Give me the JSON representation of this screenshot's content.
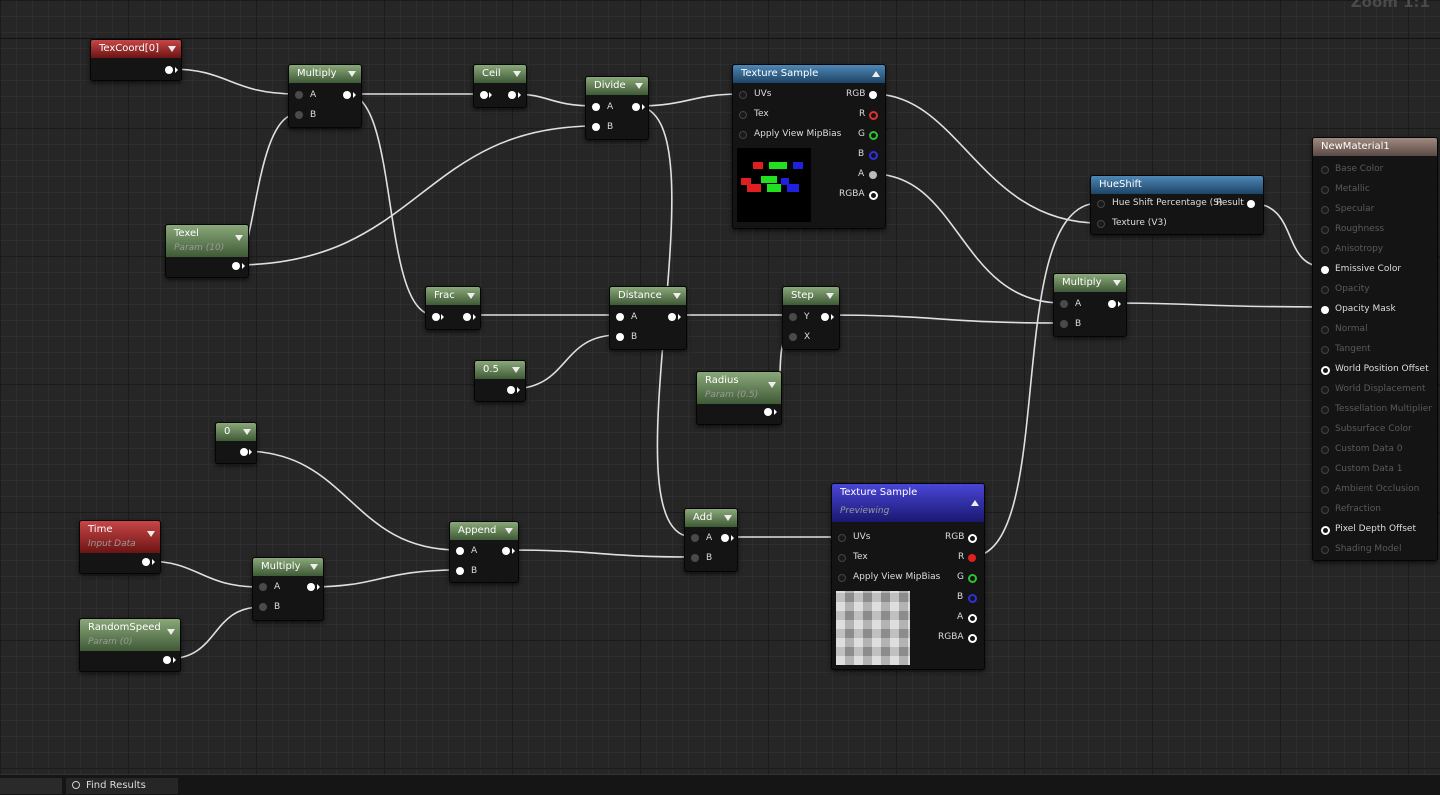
{
  "zoom_label": "Zoom 1:1",
  "status": {
    "find_results": "Find Results"
  },
  "nodes": {
    "texcoord": {
      "title": "TexCoord[0]"
    },
    "multiply1": {
      "title": "Multiply",
      "a": "A",
      "b": "B"
    },
    "ceil": {
      "title": "Ceil"
    },
    "divide": {
      "title": "Divide",
      "a": "A",
      "b": "B"
    },
    "texel": {
      "title": "Texel",
      "sub": "Param (10)"
    },
    "texsample1": {
      "title": "Texture Sample",
      "uvs": "UVs",
      "tex": "Tex",
      "mip": "Apply View MipBias",
      "rgb": "RGB",
      "r": "R",
      "g": "G",
      "b": "B",
      "a": "A",
      "rgba": "RGBA"
    },
    "hueshift": {
      "title": "HueShift",
      "in1": "Hue Shift Percentage (S)",
      "out": "Result",
      "in2": "Texture (V3)"
    },
    "multiply3": {
      "title": "Multiply",
      "a": "A",
      "b": "B"
    },
    "frac": {
      "title": "Frac"
    },
    "distance": {
      "title": "Distance",
      "a": "A",
      "b": "B"
    },
    "step": {
      "title": "Step",
      "y": "Y",
      "x": "X"
    },
    "half": {
      "title": "0.5"
    },
    "radius": {
      "title": "Radius",
      "sub": "Param (0.5)"
    },
    "zero": {
      "title": "0"
    },
    "time": {
      "title": "Time",
      "sub": "Input Data"
    },
    "append": {
      "title": "Append",
      "a": "A",
      "b": "B"
    },
    "add": {
      "title": "Add",
      "a": "A",
      "b": "B"
    },
    "multiply2": {
      "title": "Multiply",
      "a": "A",
      "b": "B"
    },
    "randomspeed": {
      "title": "RandomSpeed",
      "sub": "Param (0)"
    },
    "texsample2": {
      "title": "Texture Sample",
      "sub": "Previewing",
      "uvs": "UVs",
      "tex": "Tex",
      "mip": "Apply View MipBias",
      "rgb": "RGB",
      "r": "R",
      "g": "G",
      "b": "B",
      "a": "A",
      "rgba": "RGBA"
    }
  },
  "material": {
    "title": "NewMaterial1",
    "inputs": [
      {
        "label": "Base Color",
        "active": false
      },
      {
        "label": "Metallic",
        "active": false
      },
      {
        "label": "Specular",
        "active": false
      },
      {
        "label": "Roughness",
        "active": false
      },
      {
        "label": "Anisotropy",
        "active": false
      },
      {
        "label": "Emissive Color",
        "active": true
      },
      {
        "label": "Opacity",
        "active": false
      },
      {
        "label": "Opacity Mask",
        "active": true
      },
      {
        "label": "Normal",
        "active": false
      },
      {
        "label": "Tangent",
        "active": false
      },
      {
        "label": "World Position Offset",
        "active": true
      },
      {
        "label": "World Displacement",
        "active": false
      },
      {
        "label": "Tessellation Multiplier",
        "active": false
      },
      {
        "label": "Subsurface Color",
        "active": false
      },
      {
        "label": "Custom Data 0",
        "active": false
      },
      {
        "label": "Custom Data 1",
        "active": false
      },
      {
        "label": "Ambient Occlusion",
        "active": false
      },
      {
        "label": "Refraction",
        "active": false
      },
      {
        "label": "Pixel Depth Offset",
        "active": true
      },
      {
        "label": "Shading Model",
        "active": false
      }
    ]
  },
  "colors": {
    "param_green": "#3f5a36",
    "coord_red": "#6c1414",
    "texture_blue": "#1d4466",
    "preview_purple": "#1a1870",
    "result_brown": "#5a4a44",
    "wire": "#e0e0e0"
  }
}
